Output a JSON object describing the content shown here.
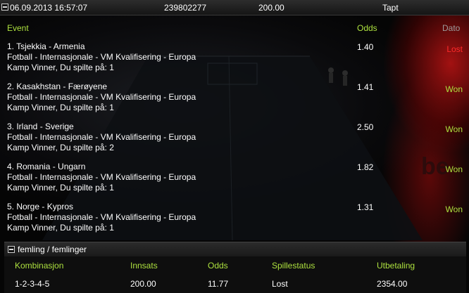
{
  "topbar": {
    "datetime": "06.09.2013 16:57:07",
    "ticket_id": "239802277",
    "stake": "200.00",
    "result": "Tapt"
  },
  "headers": {
    "event": "Event",
    "odds": "Odds",
    "date": "Dato"
  },
  "events": [
    {
      "title": "1. Tsjekkia - Armenia",
      "competition": "Fotball - Internasjonale - VM Kvalifisering - Europa",
      "bet": "Kamp Vinner, Du spilte på: 1",
      "odds": "1.40",
      "status": "Lost"
    },
    {
      "title": "2. Kasakhstan - Færøyene",
      "competition": "Fotball - Internasjonale - VM Kvalifisering - Europa",
      "bet": "Kamp Vinner, Du spilte på: 1",
      "odds": "1.41",
      "status": "Won"
    },
    {
      "title": "3. Irland - Sverige",
      "competition": "Fotball - Internasjonale - VM Kvalifisering - Europa",
      "bet": "Kamp Vinner, Du spilte på: 2",
      "odds": "2.50",
      "status": "Won"
    },
    {
      "title": "4. Romania - Ungarn",
      "competition": "Fotball - Internasjonale - VM Kvalifisering - Europa",
      "bet": "Kamp Vinner, Du spilte på: 1",
      "odds": "1.82",
      "status": "Won"
    },
    {
      "title": "5. Norge - Kypros",
      "competition": "Fotball - Internasjonale - VM Kvalifisering - Europa",
      "bet": "Kamp Vinner, Du spilte på: 1",
      "odds": "1.31",
      "status": "Won"
    }
  ],
  "system": {
    "title": "femling / femlinger",
    "headers": {
      "combination": "Kombinasjon",
      "stake": "Innsats",
      "odds": "Odds",
      "status": "Spillestatus",
      "payout": "Utbetaling"
    },
    "values": {
      "combination": "1-2-3-4-5",
      "stake": "200.00",
      "odds": "11.77",
      "status": "Lost",
      "payout": "2354.00"
    }
  },
  "colors": {
    "accent": "#aee23f",
    "lost": "#ff2a2a",
    "background": "#050505"
  }
}
